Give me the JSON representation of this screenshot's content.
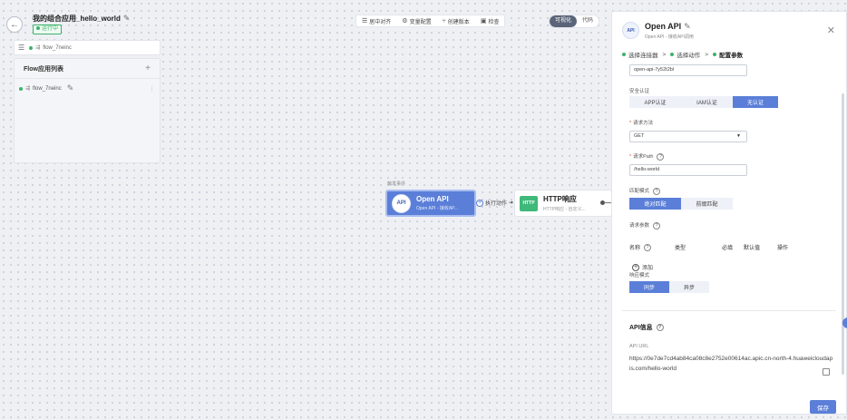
{
  "header": {
    "back_icon": "arrow-left-icon",
    "app_title": "我的组合应用_hello_world",
    "status": "运行中"
  },
  "sidebar": {
    "tab_label": "flow_7neinc",
    "list_title": "Flow应用列表",
    "items": [
      {
        "label": "flow_7neinc"
      }
    ]
  },
  "toolbar": {
    "items": [
      {
        "icon": "align-center-icon",
        "label": "居中对齐"
      },
      {
        "icon": "gear-icon",
        "label": "变量配置"
      },
      {
        "icon": "branch-icon",
        "label": "创建版本"
      },
      {
        "icon": "check-icon",
        "label": "检查"
      }
    ],
    "modes": [
      "可视化",
      "代码"
    ]
  },
  "canvas": {
    "trigger_label": "触发事件",
    "open_node": {
      "title": "Open API",
      "subtitle": "Open API - 接收AP..."
    },
    "connector_label": "执行动作",
    "http_node": {
      "title": "HTTP响应",
      "subtitle": "HTTP响应 - 自定义..."
    }
  },
  "panel": {
    "title": "Open API",
    "subtitle": "Open API - 接收API调用",
    "steps": [
      "选择连接器",
      "选择动作",
      "配置参数"
    ],
    "name_value": "open-api-7y52t2bl",
    "auth_label": "安全认证",
    "auth_options": [
      "APP认证",
      "IAM认证",
      "无认证"
    ],
    "method_label": "请求方法",
    "method_value": "GET",
    "path_label": "请求Path",
    "path_value": "/hello-world",
    "match_label": "匹配模式",
    "match_options": [
      "绝对匹配",
      "前缀匹配"
    ],
    "params_label": "请求参数",
    "param_columns": [
      "名称",
      "类型",
      "必填",
      "默认值",
      "操作"
    ],
    "add_label": "添加",
    "response_label": "响应模式",
    "response_options": [
      "同步",
      "异步"
    ],
    "api_info_title": "API信息",
    "api_url_label": "API URL",
    "api_url": "https://0e7de7cd4ab84ca08c8e2752e00614ac.apic.cn-north-4.huaweicloudapis.com/hello-world",
    "save_label": "保存"
  },
  "colors": {
    "primary": "#5b7fd8",
    "success": "#3bb46a",
    "required": "#e0493a"
  }
}
